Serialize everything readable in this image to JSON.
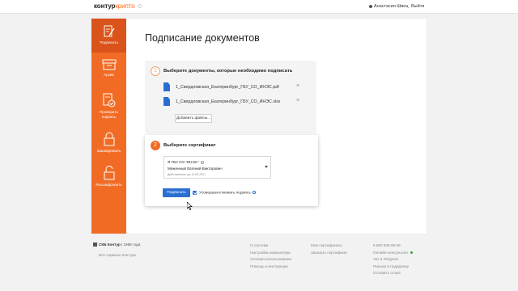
{
  "header": {
    "logo_primary": "контур",
    "logo_secondary": "крипто",
    "user_name": "Анастасия Швец",
    "logout": "Выйти"
  },
  "sidebar": {
    "items": [
      {
        "label": "Подписать",
        "icon": "sign-document-icon",
        "active": true
      },
      {
        "label": "Архив",
        "icon": "archive-icon"
      },
      {
        "label": "Проверить подпись",
        "icon": "verify-signature-icon"
      },
      {
        "label": "Зашифровать",
        "icon": "lock-icon"
      },
      {
        "label": "Расшифровать",
        "icon": "unlock-icon"
      }
    ]
  },
  "main": {
    "title": "Подписание документов",
    "step1": {
      "number": "1",
      "title": "Выберите документы, которые необходимо подписать",
      "files": [
        {
          "name": "1_Свердловская_Екатеринбург_ГБУ_СО_ИНЭС.pdf"
        },
        {
          "name": "1_Свердловская_Екатеринбург_ГБУ_СО_ИНЭС.xlsx"
        }
      ],
      "add_button": "Добавить файлы..."
    },
    "step2": {
      "number": "2",
      "title": "Выберите сертификат",
      "certificate": {
        "org": "Я ГБУ СО \"ИНЭС\"",
        "owner": "Меженный Евгений Викторович",
        "valid": "Действителен до 11.05.2021"
      },
      "sign_button": "Подписать",
      "detached_label": "Усовершенствовать подпись",
      "detached_checked": true
    }
  },
  "footer": {
    "brand": "СКБ Контур",
    "since": "1988 года",
    "all_services": "Все сервисы Контура",
    "col1": [
      "О системе",
      "Настройка компьютера",
      "Условия использования",
      "Помощь и инструкции"
    ],
    "col2": [
      "Мои сертификаты",
      "Заказать сертификат"
    ],
    "col3": [
      "8 800 500-05-08",
      "Онлайн-консультант",
      "Чат в Telegram",
      "Письмо в поддержку",
      "Оставить отзыв"
    ]
  },
  "colors": {
    "accent": "#f26b25",
    "primary_button": "#2a6ed1",
    "online": "#2ea24a"
  }
}
